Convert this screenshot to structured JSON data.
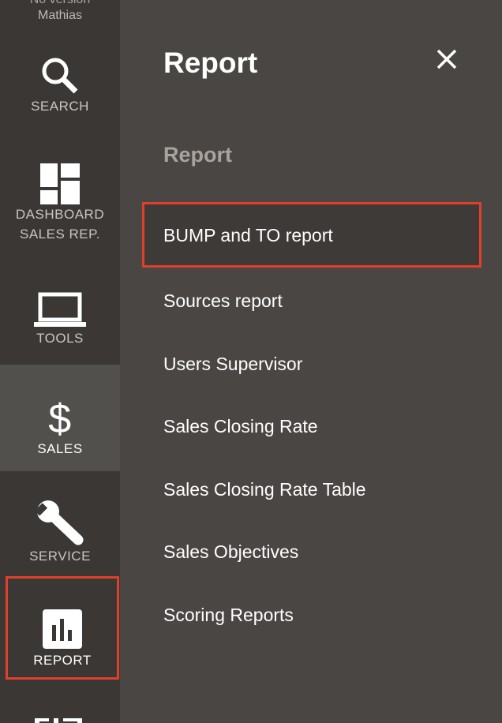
{
  "sidebar": {
    "version": {
      "line1": "No version",
      "line2": "Mathias"
    },
    "items": [
      {
        "label": "SEARCH",
        "icon": "search-icon"
      },
      {
        "label_line1": "DASHBOARD",
        "label_line2": "SALES REP.",
        "icon": "dashboard-icon"
      },
      {
        "label": "TOOLS",
        "icon": "laptop-icon"
      },
      {
        "label": "SALES",
        "icon": "dollar-icon",
        "active": true
      },
      {
        "label": "SERVICE",
        "icon": "wrench-icon"
      },
      {
        "label": "REPORT",
        "icon": "bar-chart-icon",
        "highlighted": true
      }
    ]
  },
  "panel": {
    "title": "Report",
    "close_icon": "close-icon",
    "section_header": "Report",
    "menu_items": [
      "BUMP and TO report",
      "Sources report",
      "Users Supervisor",
      "Sales Closing Rate",
      "Sales Closing Rate Table",
      "Sales Objectives",
      "Scoring Reports"
    ],
    "selected_index": 0
  },
  "colors": {
    "sidebar_bg": "#3a3735",
    "panel_bg": "#4a4644",
    "active_item_bg": "#52504d",
    "highlight_border": "#e0402b",
    "section_header_text": "#a9a39e"
  }
}
